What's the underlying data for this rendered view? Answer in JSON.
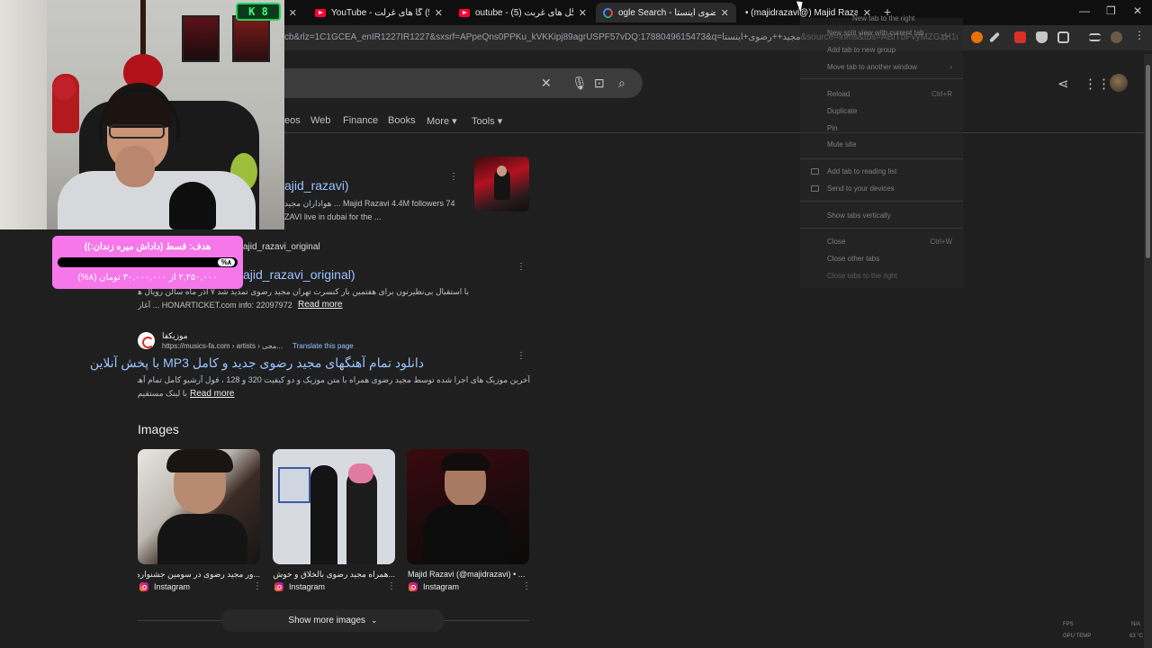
{
  "browser": {
    "tabs": [
      {
        "title": "",
        "active": false,
        "kind": "none"
      },
      {
        "title": "YouTube - جعفر (5) گا های غرلت",
        "active": false,
        "kind": "youtube"
      },
      {
        "title": "outube - جعفر گل های غربت (5)",
        "active": false,
        "kind": "youtube"
      },
      {
        "title": "ogle Search - مجید رضوی اینستا",
        "active": true,
        "kind": "google"
      },
      {
        "title": "• (majidrazavi@) Majid Razavi",
        "active": false,
        "kind": "instagram"
      }
    ],
    "new_tab": "+",
    "window_controls": {
      "minimize": "—",
      "maximize": "❐",
      "close": "✕"
    },
    "url": "cb&rlz=1C1GCEA_enIR1227IR1227&sxsrf=APpeQns0PPKu_kVKKipj89agrUSPF57vDQ:1788049615473&q=مجید++رضوی+اینستا&source=lnms&tbs=ABiTbFvyMZGzH1nvX9uR..."
  },
  "search": {
    "filters": [
      "eos",
      "Web",
      "Finance",
      "Books",
      "More ▾",
      "Tools ▾"
    ]
  },
  "results": [
    {
      "link": "ajid_razavi)",
      "snippet": "هواداران مجید ... Majid Razavi 4.4M followers 74",
      "snippet2": "ZAVI live in dubai for the ..."
    },
    {
      "url": "ajid_razavi_original",
      "link": "ajid_razavi_original)",
      "snippet": "با استقبال بی‌نظیرتون برای هفتمین بار کنسرت تهران مجید رضوی تمدید شد ۷ آذر ماه سالن رویال هتل اسپیناس خرید بلیط",
      "snippet2": "آغاز ... HONARTICKET.com info: 22097972",
      "read_more": "Read more"
    },
    {
      "site": "موزیکفا",
      "url": "https://musics-fa.com › artists › مجی...",
      "translate": "Translate this page",
      "link": "دانلود تمام آهنگهای مجید رضوی جدید و کامل MP3 با پخش آنلاین",
      "snippet": "آخرین موزیک های اجرا شده توسط مجید رضوی همراه با متن موزیک و دو کیفیت 320 و 128 ، فول آرشیو کامل تمام آهنگ های مجید رضوی",
      "snippet2": "با لینک مستقیم ...",
      "read_more": "Read more"
    }
  ],
  "images": {
    "heading": "Images",
    "items": [
      {
        "caption": "...ور مجید رضوی در سومین جشنواره حا",
        "source": "Instagram"
      },
      {
        "caption": "...همراه مجید رضوی بالخلاق و خوش اجرا",
        "source": "Instagram"
      },
      {
        "caption": "Majid Razavi (@majidrazavi) • ...",
        "source": "Instagram"
      }
    ],
    "show_more": "Show more images"
  },
  "context_menu": {
    "items": [
      {
        "label": "New tab to the right",
        "shortcut": ""
      },
      {
        "label": "New split view with current tab",
        "shortcut": ""
      },
      {
        "label": "Add tab to new group",
        "shortcut": ""
      },
      {
        "label": "Move tab to another window",
        "shortcut": "›"
      },
      {
        "label": "Reload",
        "shortcut": "Ctrl+R"
      },
      {
        "label": "Duplicate",
        "shortcut": ""
      },
      {
        "label": "Pin",
        "shortcut": ""
      },
      {
        "label": "Mute site",
        "shortcut": ""
      },
      {
        "label": "Add tab to reading list",
        "shortcut": ""
      },
      {
        "label": "Send to your devices",
        "shortcut": ""
      },
      {
        "label": "Show tabs vertically",
        "shortcut": ""
      },
      {
        "label": "Close",
        "shortcut": "Ctrl+W"
      },
      {
        "label": "Close other tabs",
        "shortcut": ""
      },
      {
        "label": "Close tabs to the right",
        "shortcut": ""
      }
    ]
  },
  "overlay": {
    "game_badge": "K 8",
    "goal_title": "هدف: قسط (داداش میره زندان:))",
    "goal_percent": "%۸",
    "goal_fraction": 0.08,
    "goal_amount": "۲,۲۵۰,۰۰۰ از ۳۰,۰۰۰,۰۰۰ تومان (۸%)"
  },
  "hud": {
    "fps_label": "FPS",
    "fps_value": "N/A",
    "gpu_label": "GPU TEMP",
    "gpu_value": "63 °C"
  },
  "colors": {
    "link": "#99c3ff",
    "goal_bg": "#f577e9",
    "page_bg": "#1f1f1f"
  }
}
